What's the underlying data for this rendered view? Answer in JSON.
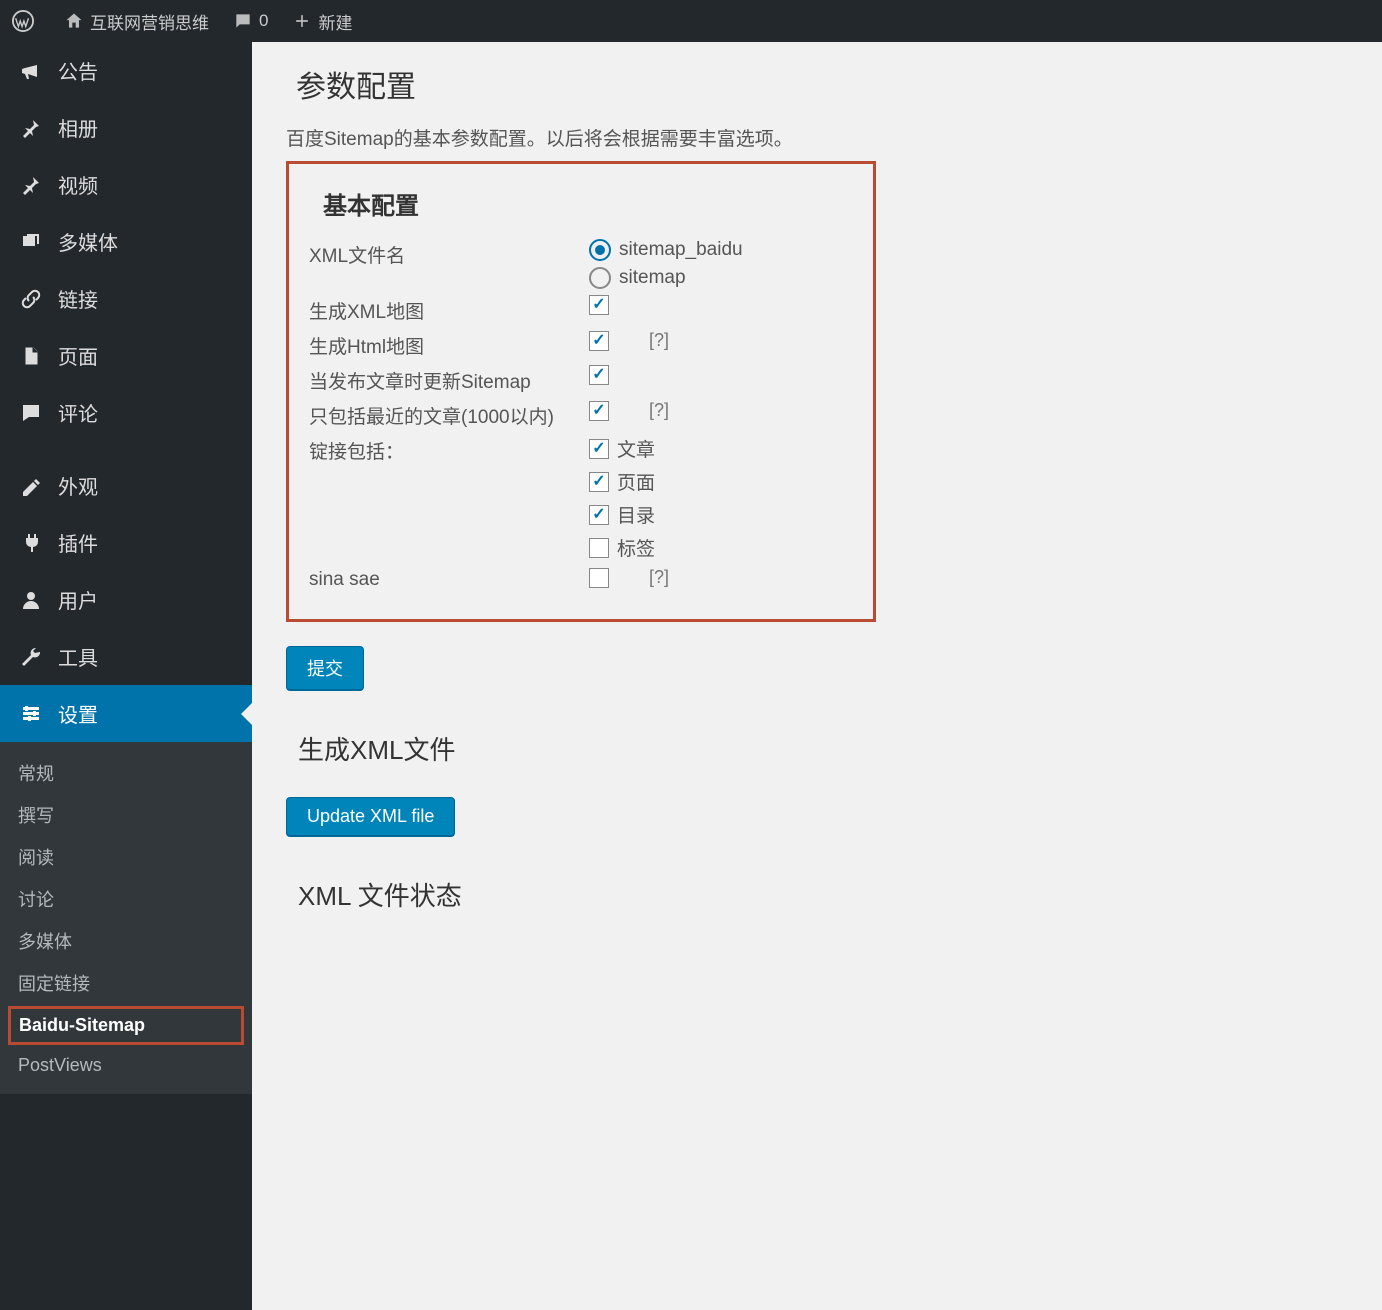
{
  "toolbar": {
    "site_name": "互联网营销思维",
    "comment_count": "0",
    "new_label": "新建"
  },
  "sidebar": {
    "items": [
      {
        "icon": "megaphone",
        "label": "公告"
      },
      {
        "icon": "pin",
        "label": "相册"
      },
      {
        "icon": "pin",
        "label": "视频"
      },
      {
        "icon": "media",
        "label": "多媒体"
      },
      {
        "icon": "link",
        "label": "链接"
      },
      {
        "icon": "page",
        "label": "页面"
      },
      {
        "icon": "comment",
        "label": "评论"
      },
      {
        "icon": "appearance",
        "label": "外观"
      },
      {
        "icon": "plugin",
        "label": "插件"
      },
      {
        "icon": "user",
        "label": "用户"
      },
      {
        "icon": "tool",
        "label": "工具"
      },
      {
        "icon": "settings",
        "label": "设置",
        "active": true
      }
    ],
    "submenu": [
      {
        "label": "常规"
      },
      {
        "label": "撰写"
      },
      {
        "label": "阅读"
      },
      {
        "label": "讨论"
      },
      {
        "label": "多媒体"
      },
      {
        "label": "固定链接"
      },
      {
        "label": "Baidu-Sitemap",
        "current": true,
        "highlighted": true
      },
      {
        "label": "PostViews"
      }
    ]
  },
  "main": {
    "title": "参数配置",
    "description": "百度Sitemap的基本参数配置。以后将会根据需要丰富选项。",
    "section_heading": "基本配置",
    "fields": {
      "xml_filename_label": "XML文件名",
      "xml_filename_options": [
        "sitemap_baidu",
        "sitemap"
      ],
      "xml_filename_selected": "sitemap_baidu",
      "gen_xml_label": "生成XML地图",
      "gen_xml_checked": true,
      "gen_html_label": "生成Html地图",
      "gen_html_checked": true,
      "update_on_publish_label": "当发布文章时更新Sitemap",
      "update_on_publish_checked": true,
      "recent_only_label": "只包括最近的文章(1000以内)",
      "recent_only_checked": true,
      "links_include_label": "锭接包括：",
      "links_include_options": [
        {
          "label": "文章",
          "checked": true
        },
        {
          "label": "页面",
          "checked": true
        },
        {
          "label": "目录",
          "checked": true
        },
        {
          "label": "标签",
          "checked": false
        }
      ],
      "sina_sae_label": "sina sae",
      "sina_sae_checked": false,
      "help_text": "[?]"
    },
    "submit_label": "提交",
    "gen_xml_heading": "生成XML文件",
    "update_btn_label": "Update XML file",
    "xml_status_heading": "XML 文件状态"
  }
}
